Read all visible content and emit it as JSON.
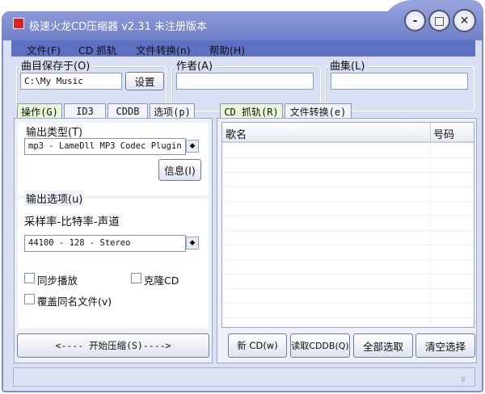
{
  "window": {
    "title": "极速火龙CD压缩器 v2.31 未注册版本",
    "minimize": "-",
    "maximize": "□",
    "close": "✕"
  },
  "menu": [
    "文件(F)",
    "CD 抓轨",
    "文件转换(n)",
    "帮助(H)"
  ],
  "save": {
    "label": "曲目保存于(O)",
    "value": "C:\\My Music",
    "button": "设置"
  },
  "author": {
    "label": "作者(A)",
    "value": ""
  },
  "album": {
    "label": "曲集(L)",
    "value": ""
  },
  "left_tabs": [
    "操作(G)",
    "ID3",
    "CDDB",
    "选项(p)"
  ],
  "right_tabs": [
    "CD 抓轨(R)",
    "文件转换(e)"
  ],
  "output_type": {
    "label": "输出类型(T)",
    "value": "mp3 - LameDll MP3 Codec Plugin",
    "info_button": "信息(I)"
  },
  "output_options": {
    "label": "输出选项(u)",
    "sublabel": "采样率-比特率-声道",
    "value": "44100 - 128 - Stereo"
  },
  "checkboxes": [
    {
      "label": "同步播放",
      "checked": false
    },
    {
      "label": "克隆CD",
      "checked": false
    },
    {
      "label": "覆盖同名文件(v)",
      "checked": false
    }
  ],
  "start_button": "<---- 开始压缩(S)---->",
  "list": {
    "columns": [
      "歌名",
      "号码"
    ],
    "rows": []
  },
  "buttons": [
    "新 CD(w)",
    "读取CDDB(Q)",
    "全部选取",
    "清空选择"
  ]
}
